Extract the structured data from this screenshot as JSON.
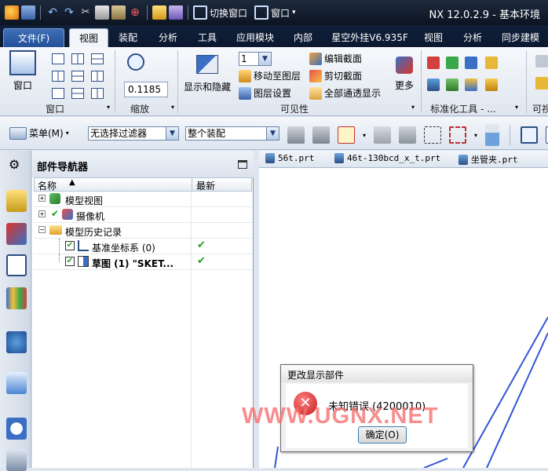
{
  "window": {
    "title": "NX 12.0.2.9 - 基本环境",
    "switch_window": "切换窗口",
    "window_menu": "窗口"
  },
  "tabs": [
    {
      "label": "文件(F)"
    },
    {
      "label": "视图"
    },
    {
      "label": "装配"
    },
    {
      "label": "分析"
    },
    {
      "label": "工具"
    },
    {
      "label": "应用模块"
    },
    {
      "label": "内部"
    },
    {
      "label": "星空外挂V6.935F"
    },
    {
      "label": "视图"
    },
    {
      "label": "分析"
    },
    {
      "label": "同步建模"
    }
  ],
  "ribbon": {
    "window_button": "窗口",
    "window_group": "窗口",
    "zoom_value": "0.1185",
    "zoom_group": "缩放",
    "show_hide": "显示和隐藏",
    "layer_value": "1",
    "move_to_layer": "移动至图层",
    "layer_settings": "图层设置",
    "edit_section": "编辑截面",
    "clip_section": "剪切截面",
    "all_transparent": "全部通透显示",
    "more": "更多",
    "visibility_group": "可见性",
    "std_tools_group": "标准化工具 - ...",
    "right_group_partial": "可视"
  },
  "toolbar": {
    "menu_label": "菜单(M)",
    "filter_value": "无选择过滤器",
    "assembly_value": "整个装配"
  },
  "navigator": {
    "title": "部件导航器",
    "col_name": "名称",
    "col_latest": "最新",
    "rows": [
      {
        "label": "模型视图",
        "check": ""
      },
      {
        "label": "摄像机",
        "check": ""
      },
      {
        "label": "模型历史记录",
        "check": ""
      },
      {
        "label": "基准坐标系 (0)",
        "check": "✔"
      },
      {
        "label": "草图 (1) \"SKET...",
        "check": "✔"
      }
    ]
  },
  "file_tabs": [
    {
      "label": "56t.prt"
    },
    {
      "label": "46t-130bcd_x_t.prt"
    },
    {
      "label": "坐管夹.prt"
    }
  ],
  "dialog": {
    "title": "更改显示部件",
    "message": "未知错误 (4200010)",
    "ok": "确定(O)"
  },
  "watermark": "WWW.UGNX.NET",
  "colors": {
    "accent": "#2c4f86",
    "titlebar": "#0c1422",
    "error": "#d8292b",
    "check": "#1fa01f"
  }
}
